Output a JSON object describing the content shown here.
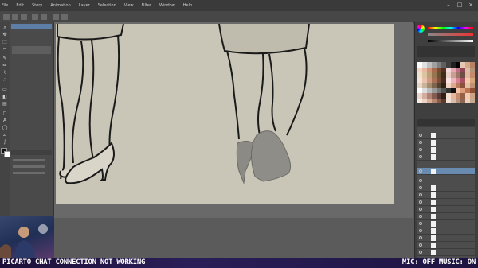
{
  "menubar": {
    "items": [
      "File",
      "Edit",
      "Story",
      "Animation",
      "Layer",
      "Selection",
      "View",
      "Filter",
      "Window",
      "Help"
    ]
  },
  "tools": [
    "zoom-icon",
    "move-icon",
    "select-icon",
    "eyedropper-icon",
    "pen-icon",
    "pencil-icon",
    "brush-icon",
    "airbrush-icon",
    "eraser-icon",
    "fill-icon",
    "gradient-icon",
    "figure-icon",
    "text-icon",
    "balloon-icon",
    "ruler-icon",
    "correct-line-icon"
  ],
  "colors": {
    "accent": "#5d7ea6",
    "canvas": "#c9c6b7",
    "banner_text": "#ffffff"
  },
  "banner": {
    "left": "PICARTO CHAT CONNECTION NOT WORKING",
    "right": "MIC: OFF MUSIC: ON"
  }
}
